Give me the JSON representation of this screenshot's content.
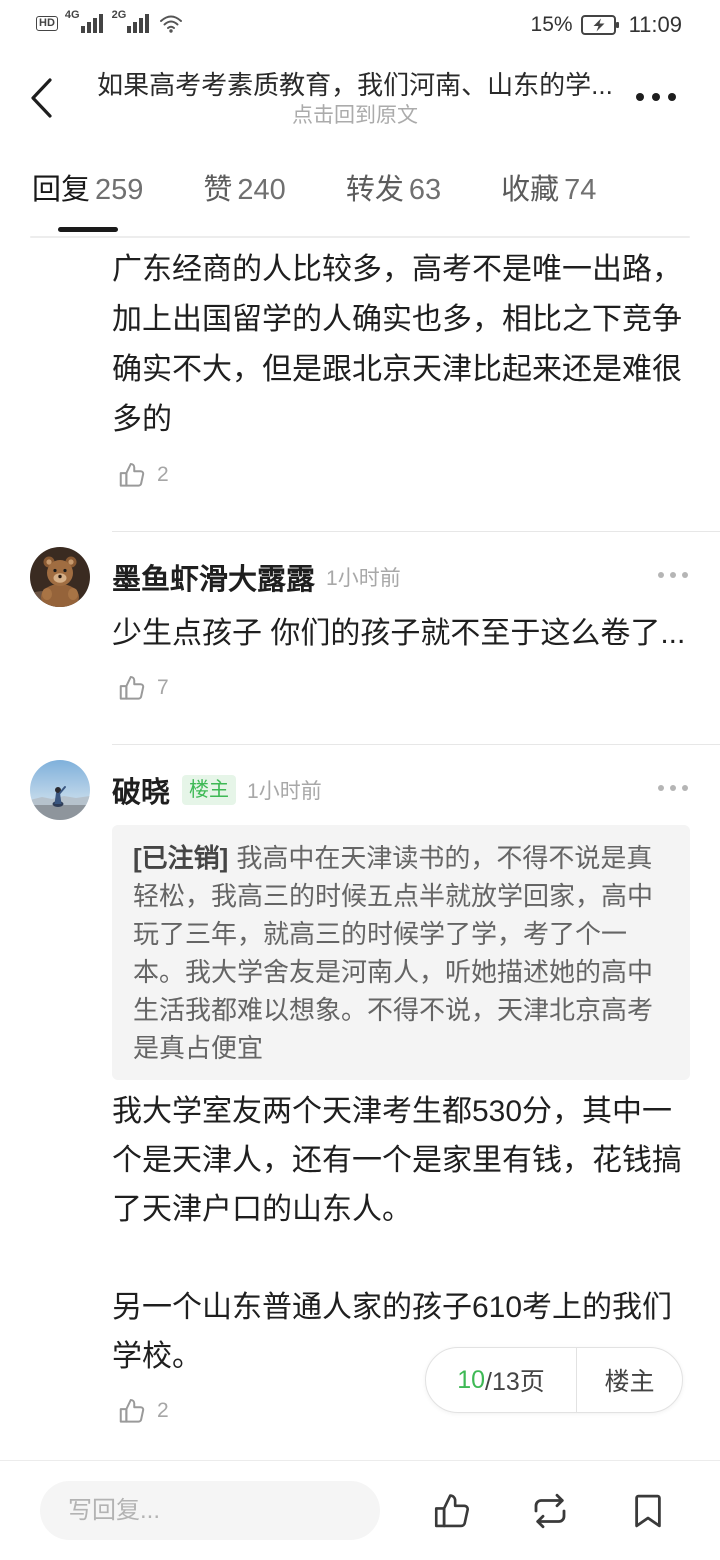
{
  "status_bar": {
    "hd_label": "HD",
    "network_primary": "4G",
    "network_secondary": "2G",
    "battery_percent": "15%",
    "charging": true,
    "time": "11:09",
    "icons": [
      "hd-voice-icon",
      "signal-4g-icon",
      "signal-2g-icon",
      "wifi-icon",
      "battery-charging-icon"
    ]
  },
  "header": {
    "title": "如果高考考素质教育，我们河南、山东的学...",
    "subtitle": "点击回到原文",
    "back_icon": "chevron-left-icon",
    "more_icon": "more-horizontal-icon"
  },
  "tabs": [
    {
      "label": "回复",
      "count": "259",
      "active": true
    },
    {
      "label": "赞",
      "count": "240",
      "active": false
    },
    {
      "label": "转发",
      "count": "63",
      "active": false
    },
    {
      "label": "收藏",
      "count": "74",
      "active": false
    }
  ],
  "comments": [
    {
      "text": "广东经商的人比较多，高考不是唯一出路，加上出国留学的人确实也多，相比之下竞争确实不大，但是跟北京天津比起来还是难很多的",
      "likes": "2",
      "like_icon": "thumbs-up-icon"
    },
    {
      "author": "墨鱼虾滑大露露",
      "time": "1小时前",
      "text": "少生点孩子 你们的孩子就不至于这么卷了...",
      "likes": "7",
      "like_icon": "thumbs-up-icon",
      "more_icon": "more-horizontal-icon"
    },
    {
      "author": "破晓",
      "badge": "楼主",
      "time": "1小时前",
      "quote": {
        "author": "[已注销]",
        "text": "我高中在天津读书的，不得不说是真轻松，我高三的时候五点半就放学回家，高中玩了三年，就高三的时候学了学，考了个一本。我大学舍友是河南人，听她描述她的高中生活我都难以想象。不得不说，天津北京高考是真占便宜"
      },
      "text": "我大学室友两个天津考生都530分，其中一个是天津人，还有一个是家里有钱，花钱搞了天津户口的山东人。\n\n另一个山东普通人家的孩子610考上的我们学校。",
      "likes": "2",
      "like_icon": "thumbs-up-icon",
      "more_icon": "more-horizontal-icon"
    }
  ],
  "pagination": {
    "current_page": "10",
    "page_total_label": "/13页",
    "op_only_label": "楼主"
  },
  "reply_bar": {
    "placeholder": "写回复...",
    "icons": [
      "thumbs-up-icon",
      "repost-icon",
      "bookmark-icon"
    ]
  },
  "colors": {
    "accent": "#3eb955",
    "badge_background": "#e6f5e8",
    "text_primary": "#1f1f1f",
    "text_secondary": "#a8a8a8",
    "quote_background": "#f4f4f4"
  }
}
